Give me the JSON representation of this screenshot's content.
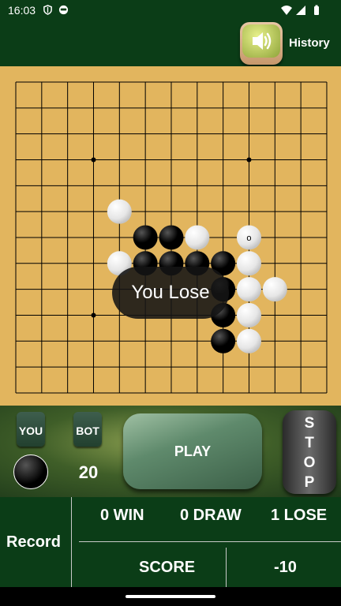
{
  "status_bar": {
    "time": "16:03",
    "left_icons": [
      "shield-icon",
      "face-icon"
    ],
    "right_icons": [
      "wifi-icon",
      "signal-icon",
      "battery-icon"
    ]
  },
  "header": {
    "sound_icon": "speaker-icon",
    "history_label": "History"
  },
  "board": {
    "size": 13,
    "star_points": [
      [
        3,
        3
      ],
      [
        9,
        3
      ],
      [
        3,
        9
      ],
      [
        9,
        9
      ]
    ],
    "black_stones": [
      [
        5,
        6
      ],
      [
        6,
        6
      ],
      [
        5,
        7
      ],
      [
        6,
        7
      ],
      [
        7,
        7
      ],
      [
        8,
        7
      ],
      [
        8,
        8
      ],
      [
        8,
        9
      ],
      [
        8,
        10
      ]
    ],
    "white_stones": [
      [
        4,
        5
      ],
      [
        7,
        6
      ],
      [
        4,
        7
      ],
      [
        9,
        7
      ],
      [
        9,
        8
      ],
      [
        10,
        8
      ],
      [
        9,
        9
      ],
      [
        9,
        10
      ]
    ],
    "last_move": [
      9,
      6
    ],
    "last_move_label": "o",
    "colors": {
      "board": "#e2b55e",
      "line": "#000000"
    }
  },
  "result_message": "You Lose",
  "panel": {
    "you_label": "YOU",
    "bot_label": "BOT",
    "player_stone": "black",
    "bot_level": "20",
    "play_label": "PLAY",
    "stop_letters": [
      "S",
      "T",
      "O",
      "P"
    ]
  },
  "record": {
    "label": "Record",
    "win": "0 WIN",
    "draw": "0 DRAW",
    "lose": "1 LOSE",
    "score_label": "SCORE",
    "score_value": "-10"
  }
}
